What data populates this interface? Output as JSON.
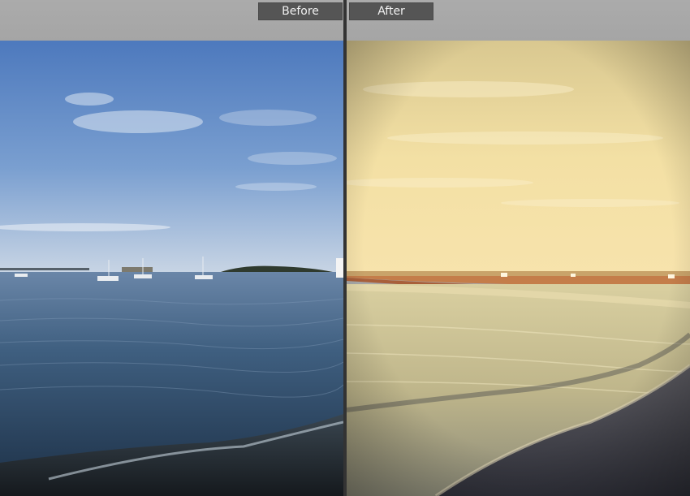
{
  "compare_view": {
    "before_label": "Before",
    "after_label": "After"
  },
  "colors": {
    "frame_bg": "#a8a8a8",
    "tab_bg": "#555555",
    "divider": "#333333",
    "before_sky": "#5a86c4",
    "after_sky": "#f2dfa2"
  }
}
